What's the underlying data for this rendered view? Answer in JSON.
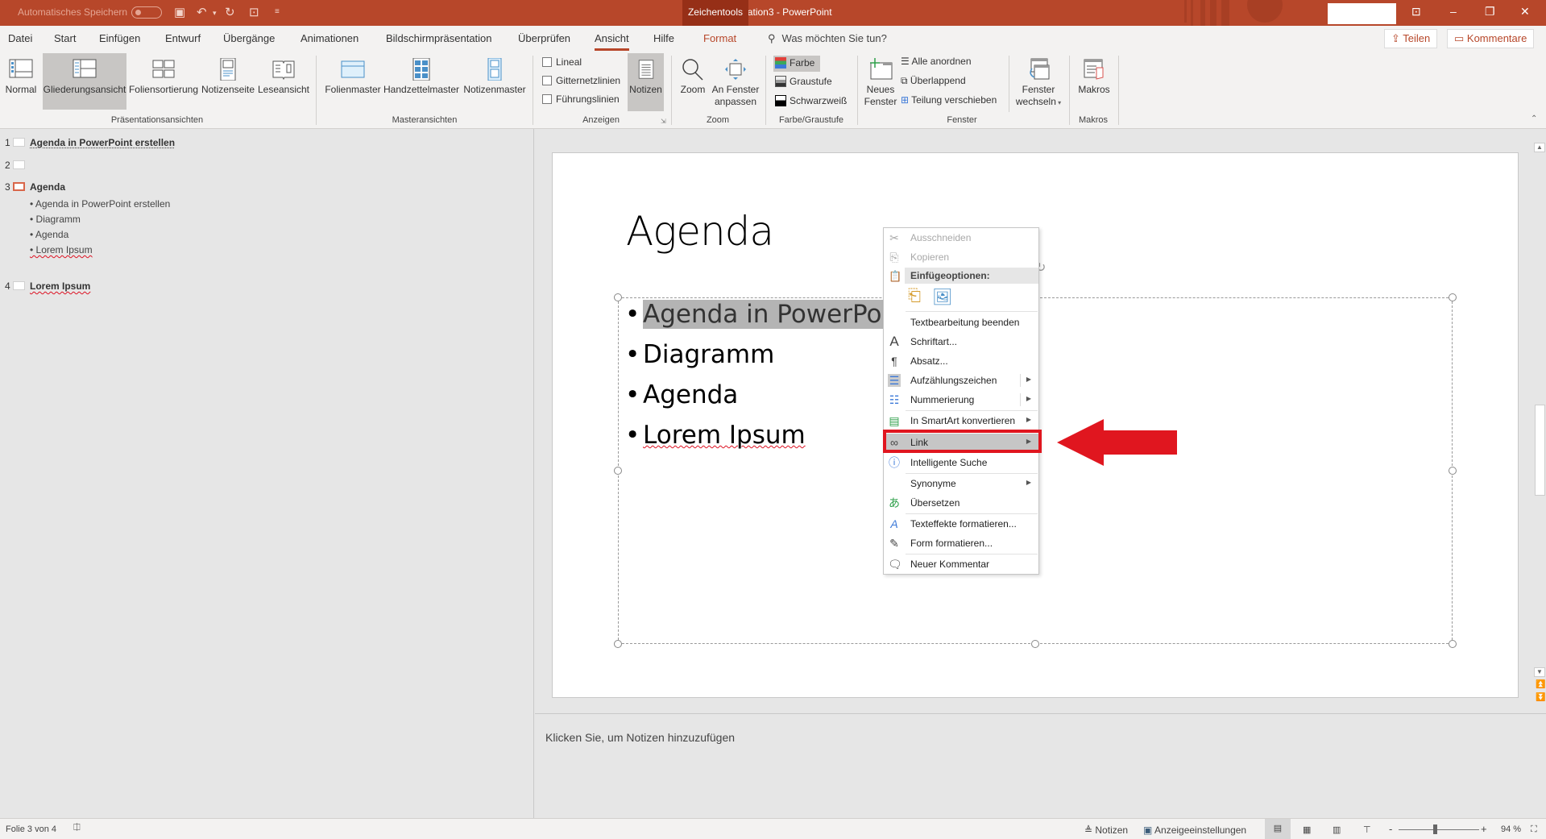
{
  "titlebar": {
    "autosave_label": "Automatisches Speichern",
    "doc_title": "Präsentation3  -  PowerPoint",
    "context_tab": "Zeichentools",
    "window_buttons": [
      "ribbon-display-options",
      "minimize",
      "restore",
      "close"
    ]
  },
  "tabs": {
    "items": [
      "Datei",
      "Start",
      "Einfügen",
      "Entwurf",
      "Übergänge",
      "Animationen",
      "Bildschirmpräsentation",
      "Überprüfen",
      "Ansicht",
      "Hilfe",
      "Format"
    ],
    "active": "Ansicht",
    "search_placeholder": "Was möchten Sie tun?",
    "share_label": "Teilen",
    "comments_label": "Kommentare"
  },
  "ribbon": {
    "groups": {
      "presentation_views": {
        "label": "Präsentationsansichten",
        "buttons": [
          "Normal",
          "Gliederungsansicht",
          "Foliensortierung",
          "Notizenseite",
          "Leseansicht"
        ],
        "selected": "Gliederungsansicht"
      },
      "master_views": {
        "label": "Masteransichten",
        "buttons": [
          "Folienmaster",
          "Handzettelmaster",
          "Notizenmaster"
        ]
      },
      "show": {
        "label": "Anzeigen",
        "checkboxes": [
          {
            "label": "Lineal",
            "checked": false
          },
          {
            "label": "Gitternetzlinien",
            "checked": false
          },
          {
            "label": "Führungslinien",
            "checked": false
          }
        ],
        "notes_button": "Notizen"
      },
      "zoom": {
        "label": "Zoom",
        "zoom_button": "Zoom",
        "fit_button_line1": "An Fenster",
        "fit_button_line2": "anpassen"
      },
      "color": {
        "label": "Farbe/Graustufe",
        "options": [
          "Farbe",
          "Graustufe",
          "Schwarzweiß"
        ],
        "selected": "Farbe"
      },
      "window": {
        "label": "Fenster",
        "new_window_line1": "Neues",
        "new_window_line2": "Fenster",
        "arrange_all": "Alle anordnen",
        "cascade": "Überlappend",
        "move_split": "Teilung verschieben",
        "switch_line1": "Fenster",
        "switch_line2": "wechseln"
      },
      "macros": {
        "label": "Makros",
        "button": "Makros"
      }
    }
  },
  "outline": {
    "slides": [
      {
        "num": "1",
        "title": "Agenda in PowerPoint erstellen",
        "bullets": []
      },
      {
        "num": "2",
        "title": "",
        "bullets": []
      },
      {
        "num": "3",
        "title": "Agenda",
        "bullets": [
          "• Agenda in PowerPoint erstellen",
          "• Diagramm",
          "• Agenda",
          "• Lorem Ipsum"
        ],
        "current": true
      },
      {
        "num": "4",
        "title": "Lorem Ipsum",
        "bullets": []
      }
    ]
  },
  "slide": {
    "title": "Agenda",
    "bullets": [
      "Agenda in PowerPoint",
      "Diagramm",
      "Agenda",
      "Lorem Ipsum"
    ],
    "bullet_char": "•"
  },
  "context_menu": {
    "items": [
      {
        "label": "Ausschneiden",
        "icon": "scissors-icon",
        "disabled": true
      },
      {
        "label": "Kopieren",
        "icon": "copy-icon",
        "disabled": true
      },
      {
        "label": "Einfügeoptionen:",
        "icon": "paste-icon",
        "header": true
      },
      {
        "label": "Textbearbeitung beenden"
      },
      {
        "label": "Schriftart...",
        "icon": "font-icon"
      },
      {
        "label": "Absatz...",
        "icon": "paragraph-icon"
      },
      {
        "label": "Aufzählungszeichen",
        "icon": "bullets-icon",
        "submenu": true
      },
      {
        "label": "Nummerierung",
        "icon": "numbering-icon",
        "submenu": true
      },
      {
        "label": "In SmartArt konvertieren",
        "icon": "smartart-icon",
        "submenu": true
      },
      {
        "label": "Link",
        "icon": "link-icon",
        "submenu": true,
        "highlighted": true
      },
      {
        "label": "Intelligente Suche",
        "icon": "smart-lookup-icon"
      },
      {
        "label": "Synonyme",
        "submenu": true
      },
      {
        "label": "Übersetzen",
        "icon": "translate-icon"
      },
      {
        "label": "Texteffekte formatieren...",
        "icon": "text-effects-icon"
      },
      {
        "label": "Form formatieren...",
        "icon": "format-shape-icon"
      },
      {
        "label": "Neuer Kommentar",
        "icon": "new-comment-icon"
      }
    ],
    "submenu_arrow": "▶"
  },
  "annotation": {
    "highlight_color": "#e0161f",
    "target": "Link"
  },
  "notes": {
    "placeholder": "Klicken Sie, um Notizen hinzuzufügen"
  },
  "statusbar": {
    "slide_info": "Folie 3 von 4",
    "notes_label": "Notizen",
    "display_settings_label": "Anzeigeeinstellungen",
    "zoom_minus": "-",
    "zoom_plus": "+",
    "zoom_level": "94 %"
  },
  "colors": {
    "accent": "#b7472a",
    "context_tab": "#962f17",
    "selection": "#c8c6c4"
  }
}
